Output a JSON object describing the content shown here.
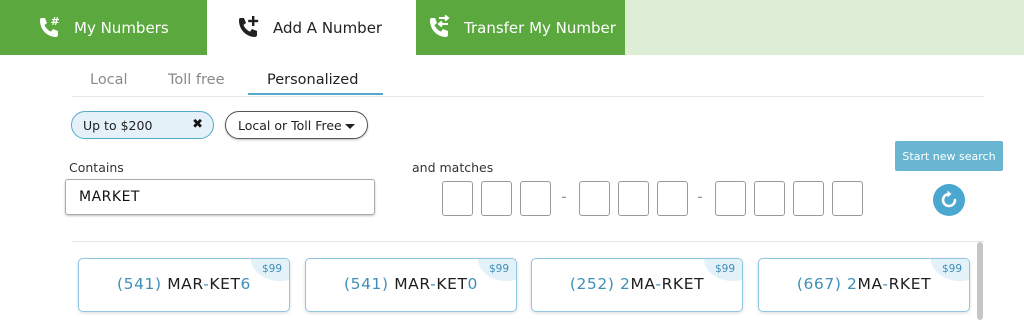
{
  "top_tabs": [
    {
      "label": "My Numbers",
      "icon": "phone-hash-icon"
    },
    {
      "label": "Add A Number",
      "icon": "phone-plus-icon"
    },
    {
      "label": "Transfer My Number",
      "icon": "phone-transfer-icon"
    }
  ],
  "sub_tabs": [
    "Local",
    "Toll free",
    "Personalized"
  ],
  "filters": {
    "price": "Up to $200",
    "price_clear": "✖",
    "type": "Local or Toll Free"
  },
  "search": {
    "contains_label": "Contains",
    "contains_value": "MARKET",
    "matches_label": "and matches",
    "matches_separators": [
      "-",
      "-"
    ],
    "new_search_label": "Start new search"
  },
  "results": [
    {
      "price": "$99",
      "area": "(541)",
      "parts": [
        "MAR",
        "-",
        "KET",
        "6"
      ]
    },
    {
      "price": "$99",
      "area": "(541)",
      "parts": [
        "MAR",
        "-",
        "KET",
        "0"
      ]
    },
    {
      "price": "$99",
      "area": "(252)",
      "parts": [
        "2",
        "MA",
        "-",
        "RKET"
      ]
    },
    {
      "price": "$99",
      "area": "(667)",
      "parts": [
        "2",
        "MA",
        "-",
        "RKET"
      ]
    }
  ],
  "colors": {
    "green": "#5aa83e",
    "accent": "#55aacc"
  }
}
